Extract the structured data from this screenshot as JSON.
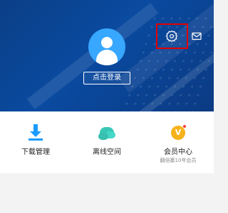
{
  "header": {
    "login_label": "点击登录",
    "settings_icon": "gear-icon",
    "mail_icon": "mail-icon"
  },
  "tiles": [
    {
      "label": "下载管理",
      "sub": "",
      "icon": "download-icon",
      "color": "#1a9bff"
    },
    {
      "label": "离线空间",
      "sub": "",
      "icon": "cloud-icon",
      "color": "#39c7b7"
    },
    {
      "label": "会员中心",
      "sub": "翻倍赢10年会员",
      "icon": "vip-icon",
      "color": "#f6b21a",
      "badge_color": "#ff3b30"
    }
  ],
  "colors": {
    "header_blue": "#0b3f86",
    "avatar_blue": "#38a7ff",
    "highlight_red": "#e10000"
  }
}
